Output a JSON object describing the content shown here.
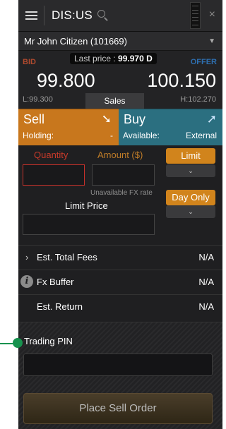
{
  "header": {
    "symbol": "DIS:US",
    "close_glyph": "×",
    "icons": [
      "menu-icon",
      "search-icon",
      "grip-icon",
      "close-icon"
    ]
  },
  "account": {
    "name": "Mr John Citizen (101669)",
    "caret": "▼"
  },
  "quote": {
    "bid_label": "BID",
    "offer_label": "OFFER",
    "last_price_label": "Last price :",
    "last_price_value": "99.970 D",
    "bid_price": "99.800",
    "offer_price": "100.150",
    "low": "L:99.300",
    "high": "H:102.270",
    "sales_tab": "Sales"
  },
  "sell": {
    "title": "Sell",
    "arrow": "➘",
    "holding_label": "Holding:",
    "holding_value": "-"
  },
  "buy": {
    "title": "Buy",
    "arrow": "➚",
    "available_label": "Available:",
    "available_value": "External"
  },
  "order": {
    "quantity_label": "Quantity",
    "amount_label": "Amount ($)",
    "order_type": "Limit",
    "duration": "Day Only",
    "fx_note": "Unavailable FX rate",
    "limit_price_label": "Limit Price",
    "dropdown_glyph": "⌄"
  },
  "summary": [
    {
      "label": "Est. Total Fees",
      "value": "N/A",
      "marker": "›"
    },
    {
      "label": "Fx Buffer",
      "value": "N/A",
      "marker": "i"
    },
    {
      "label": "Est. Return",
      "value": "N/A",
      "marker": ""
    }
  ],
  "pin": {
    "label": "Trading PIN"
  },
  "place_order": {
    "label": "Place Sell Order"
  },
  "colors": {
    "sell": "#c8771d",
    "buy": "#2b6f80",
    "bid": "#b04a2e",
    "offer": "#2e6fb0",
    "callout": "#17924e"
  }
}
